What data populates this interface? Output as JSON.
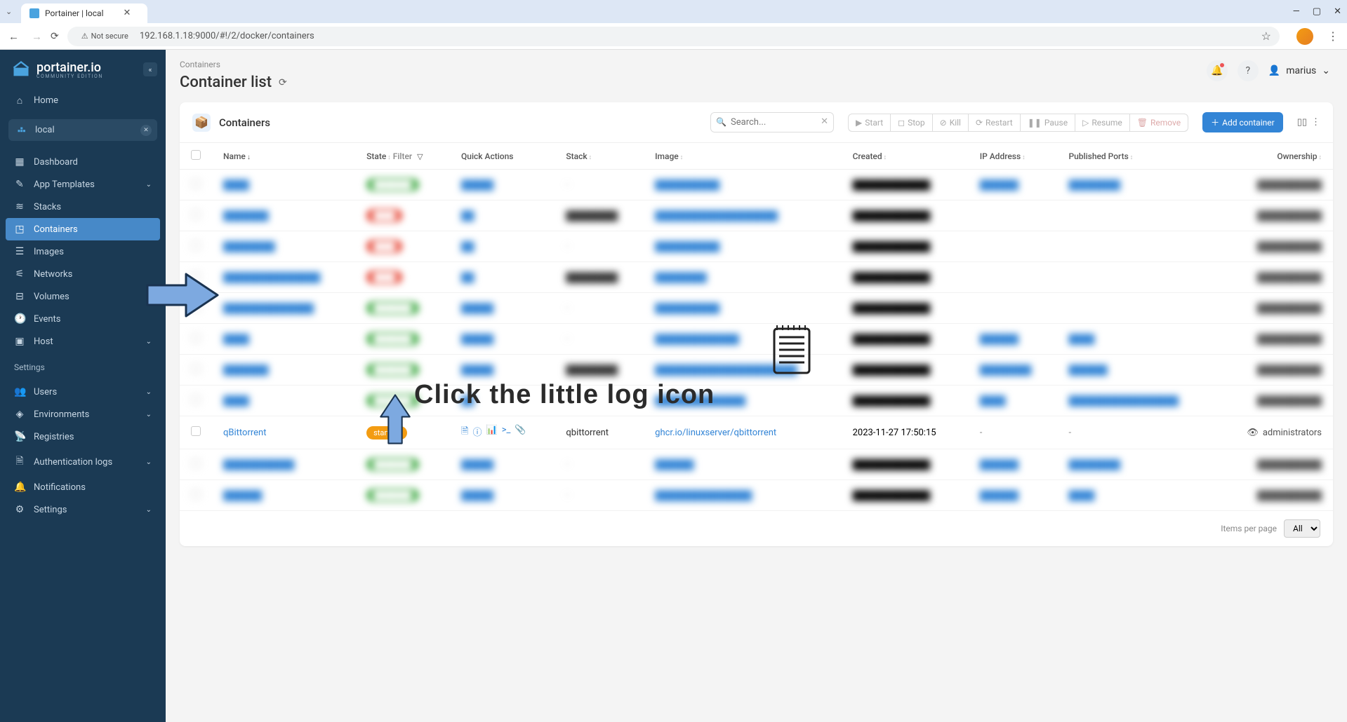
{
  "browser": {
    "tab_title": "Portainer | local",
    "not_secure": "Not secure",
    "url": "192.168.1.18:9000/#!/2/docker/containers"
  },
  "sidebar": {
    "logo": "portainer.io",
    "logo_sub": "COMMUNITY EDITION",
    "home": "Home",
    "env_name": "local",
    "items": [
      {
        "label": "Dashboard"
      },
      {
        "label": "App Templates",
        "expandable": true
      },
      {
        "label": "Stacks"
      },
      {
        "label": "Containers"
      },
      {
        "label": "Images"
      },
      {
        "label": "Networks"
      },
      {
        "label": "Volumes"
      },
      {
        "label": "Events"
      },
      {
        "label": "Host",
        "expandable": true
      }
    ],
    "settings_title": "Settings",
    "settings": [
      {
        "label": "Users",
        "expandable": true
      },
      {
        "label": "Environments",
        "expandable": true
      },
      {
        "label": "Registries"
      },
      {
        "label": "Authentication logs",
        "expandable": true
      },
      {
        "label": "Notifications"
      },
      {
        "label": "Settings",
        "expandable": true
      }
    ]
  },
  "header": {
    "breadcrumb": "Containers",
    "title": "Container list",
    "user": "marius"
  },
  "panel": {
    "title": "Containers",
    "search_placeholder": "Search...",
    "actions": {
      "start": "Start",
      "stop": "Stop",
      "kill": "Kill",
      "restart": "Restart",
      "pause": "Pause",
      "resume": "Resume",
      "remove": "Remove"
    },
    "add_label": "Add container"
  },
  "table": {
    "columns": {
      "name": "Name",
      "state": "State",
      "filter": "Filter",
      "quick_actions": "Quick Actions",
      "stack": "Stack",
      "image": "Image",
      "created": "Created",
      "ip": "IP Address",
      "ports": "Published Ports",
      "ownership": "Ownership"
    },
    "visible_row": {
      "name": "qBittorrent",
      "state": "starting",
      "stack": "qbittorrent",
      "image": "ghcr.io/linuxserver/qbittorrent",
      "created": "2023-11-27 17:50:15",
      "ip": "-",
      "ports": "-",
      "ownership": "administrators"
    },
    "footer": {
      "label": "Items per page",
      "value": "All"
    }
  },
  "annotation": {
    "text": "Click the little log icon"
  }
}
